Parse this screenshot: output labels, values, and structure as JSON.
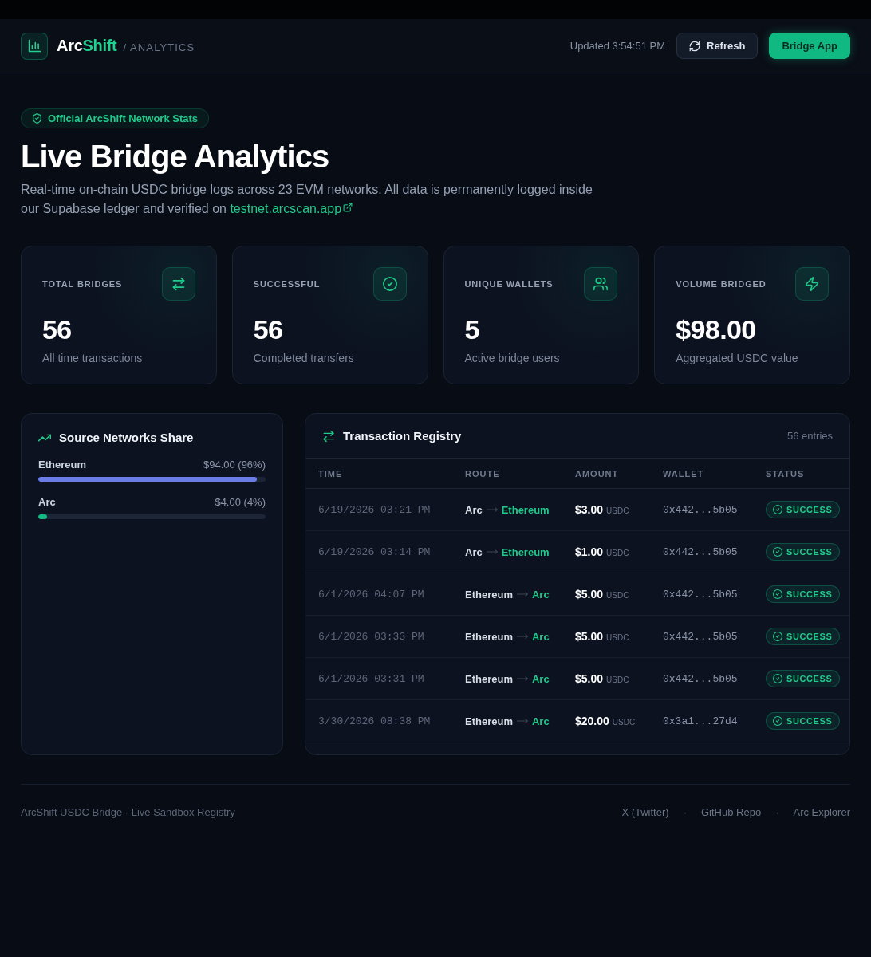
{
  "header": {
    "brand": {
      "name": "Arc",
      "suffix": "Shift"
    },
    "section": "/ ANALYTICS",
    "updated": "Updated 3:54:51 PM",
    "buttons": [
      {
        "label": "Refresh",
        "kind": "refresh"
      },
      {
        "label": "Bridge App",
        "kind": "primary"
      }
    ]
  },
  "hero": {
    "badge": "Official ArcShift Network Stats",
    "title": "Live Bridge Analytics",
    "description": "Real-time on-chain USDC bridge logs across 23 EVM networks. All data is permanently logged inside our Supabase ledger and verified on",
    "link": "testnet.arcscan.app"
  },
  "stats": [
    {
      "label": "TOTAL BRIDGES",
      "value": "56",
      "caption": "All time transactions",
      "kind": "swap"
    },
    {
      "label": "SUCCESSFUL",
      "value": "56",
      "caption": "Completed transfers",
      "kind": "check"
    },
    {
      "label": "UNIQUE WALLETS",
      "value": "5",
      "caption": "Active bridge users",
      "kind": "users"
    },
    {
      "label": "VOLUME BRIDGED",
      "value": "$98.00",
      "caption": "Aggregated USDC value",
      "kind": "bolt"
    }
  ],
  "networks_share": {
    "title": "Source Networks Share",
    "items": [
      {
        "name": "Ethereum",
        "amount": "$94.00 (96%)",
        "level": 0.96,
        "color": "#6a7de6"
      },
      {
        "name": "Arc",
        "amount": "$4.00 (4%)",
        "level": 0.04,
        "color": "#10b981"
      }
    ]
  },
  "registry": {
    "title": "Transaction Registry",
    "count": "56 entries",
    "columns": [
      "TIME",
      "ROUTE",
      "AMOUNT",
      "WALLET",
      "STATUS"
    ],
    "rows": [
      {
        "time": "6/19/2026 03:21 PM",
        "from": "Arc",
        "to": "Ethereum",
        "amount": "$3.00",
        "unit": "USDC",
        "wallet": "0x442...5b05",
        "status": "SUCCESS",
        "kind": "success"
      },
      {
        "time": "6/19/2026 03:14 PM",
        "from": "Arc",
        "to": "Ethereum",
        "amount": "$1.00",
        "unit": "USDC",
        "wallet": "0x442...5b05",
        "status": "SUCCESS",
        "kind": "success"
      },
      {
        "time": "6/1/2026 04:07 PM",
        "from": "Ethereum",
        "to": "Arc",
        "amount": "$5.00",
        "unit": "USDC",
        "wallet": "0x442...5b05",
        "status": "SUCCESS",
        "kind": "success"
      },
      {
        "time": "6/1/2026 03:33 PM",
        "from": "Ethereum",
        "to": "Arc",
        "amount": "$5.00",
        "unit": "USDC",
        "wallet": "0x442...5b05",
        "status": "SUCCESS",
        "kind": "success"
      },
      {
        "time": "6/1/2026 03:31 PM",
        "from": "Ethereum",
        "to": "Arc",
        "amount": "$5.00",
        "unit": "USDC",
        "wallet": "0x442...5b05",
        "status": "SUCCESS",
        "kind": "success"
      },
      {
        "time": "3/30/2026 08:38 PM",
        "from": "Ethereum",
        "to": "Arc",
        "amount": "$20.00",
        "unit": "USDC",
        "wallet": "0x3a1...27d4",
        "status": "SUCCESS",
        "kind": "success"
      }
    ]
  },
  "footer": {
    "text": "ArcShift USDC Bridge · Live Sandbox Registry",
    "items": [
      {
        "kind": "link",
        "text": "X (Twitter)"
      },
      {
        "kind": "separator",
        "text": "·"
      },
      {
        "kind": "link",
        "text": "GitHub Repo"
      },
      {
        "kind": "separator",
        "text": "·"
      },
      {
        "kind": "link",
        "text": "Arc Explorer"
      }
    ]
  }
}
